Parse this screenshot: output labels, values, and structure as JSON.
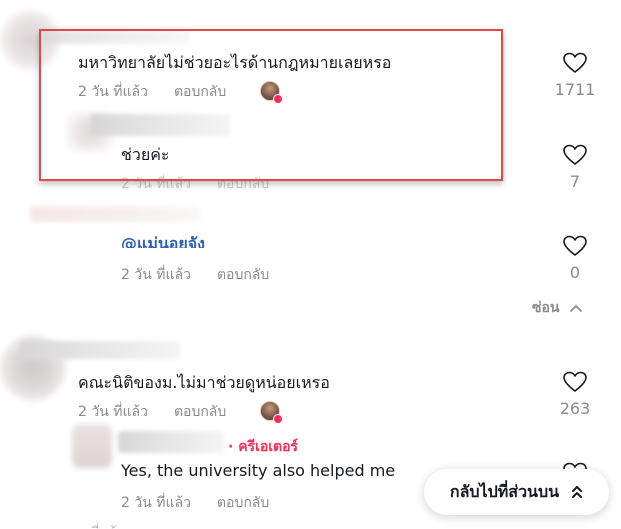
{
  "comments": [
    {
      "text": "มหาวิทยาลัยไม่ช่วยอะไรด้านกฎหมายเลยหรอ",
      "age": "2 วัน ที่แล้ว",
      "reply": "ตอบกลับ",
      "likes": "1711"
    },
    {
      "text": "ช่วยค่ะ",
      "age": "2 วัน ที่แล้ว",
      "reply": "ตอบกลับ",
      "likes": "7"
    },
    {
      "text": "@แม่นอยจัง",
      "age": "2 วัน ที่แล้ว",
      "reply": "ตอบกลับ",
      "likes": "0"
    },
    {
      "text": "คณะนิติของม.ไม่มาช่วยดูหน่อยเหรอ",
      "age": "2 วัน ที่แล้ว",
      "reply": "ตอบกลับ",
      "likes": "263"
    },
    {
      "creator_tag": "· ครีเอเตอร์",
      "text": "Yes, the university also helped me",
      "age": "2 วัน ที่แล้ว",
      "reply": "ตอบกลับ"
    }
  ],
  "hide_label": "ซ่อน",
  "back_to_top": "กลับไปที่ส่วนบน",
  "colors": {
    "highlight_box": "#e0484a",
    "creator": "#fe2c55",
    "mention": "#2b5db9"
  }
}
